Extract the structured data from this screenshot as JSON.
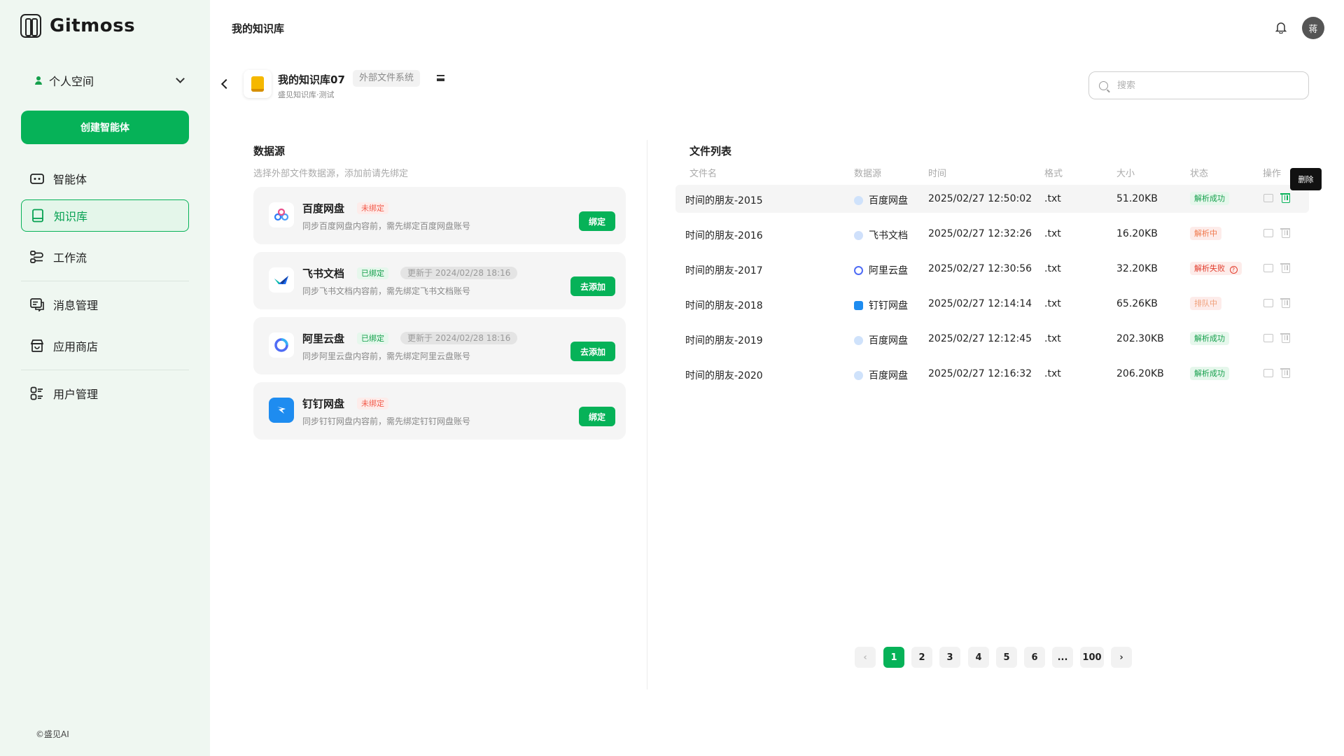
{
  "brand": {
    "name": "Gitmoss"
  },
  "sidebar": {
    "space_label": "个人空间",
    "create_button": "创建智能体",
    "items": [
      {
        "label": "智能体"
      },
      {
        "label": "知识库"
      },
      {
        "label": "工作流"
      },
      {
        "label": "消息管理"
      },
      {
        "label": "应用商店"
      },
      {
        "label": "用户管理"
      }
    ],
    "footer": "©盛见AI"
  },
  "header": {
    "title": "我的知识库",
    "avatar_text": "蒋"
  },
  "kb": {
    "title": "我的知识库07",
    "tag": "外部文件系统",
    "subtitle": "盛见知识库·测试"
  },
  "search": {
    "placeholder": "搜索"
  },
  "sources": {
    "title": "数据源",
    "subtitle": "选择外部文件数据源，添加前请先绑定",
    "items": [
      {
        "name": "百度网盘",
        "status": "未绑定",
        "updated": "",
        "desc": "同步百度网盘内容前，需先绑定百度网盘账号",
        "action": "绑定"
      },
      {
        "name": "飞书文档",
        "status": "已绑定",
        "updated": "更新于 2024/02/28 18:16",
        "desc": "同步飞书文档内容前，需先绑定飞书文档账号",
        "action": "去添加"
      },
      {
        "name": "阿里云盘",
        "status": "已绑定",
        "updated": "更新于 2024/02/28 18:16",
        "desc": "同步阿里云盘内容前，需先绑定阿里云盘账号",
        "action": "去添加"
      },
      {
        "name": "钉钉网盘",
        "status": "未绑定",
        "updated": "",
        "desc": "同步钉钉网盘内容前，需先绑定钉钉网盘账号",
        "action": "绑定"
      }
    ]
  },
  "files": {
    "title": "文件列表",
    "columns": [
      "文件名",
      "数据源",
      "时间",
      "格式",
      "大小",
      "状态",
      "操作"
    ],
    "rows": [
      {
        "name": "时间的朋友-2015",
        "source": "百度网盘",
        "time": "2025/02/27  12:50:02",
        "format": ".txt",
        "size": "51.20KB",
        "status": "解析成功"
      },
      {
        "name": "时间的朋友-2016",
        "source": "飞书文档",
        "time": "2025/02/27  12:32:26",
        "format": ".txt",
        "size": "16.20KB",
        "status": "解析中"
      },
      {
        "name": "时间的朋友-2017",
        "source": "阿里云盘",
        "time": "2025/02/27  12:30:56",
        "format": ".txt",
        "size": "32.20KB",
        "status": "解析失败"
      },
      {
        "name": "时间的朋友-2018",
        "source": "钉钉网盘",
        "time": "2025/02/27  12:14:14",
        "format": ".txt",
        "size": "65.26KB",
        "status": "排队中"
      },
      {
        "name": "时间的朋友-2019",
        "source": "百度网盘",
        "time": "2025/02/27  12:12:45",
        "format": ".txt",
        "size": "202.30KB",
        "status": "解析成功"
      },
      {
        "name": "时间的朋友-2020",
        "source": "百度网盘",
        "time": "2025/02/27  12:16:32",
        "format": ".txt",
        "size": "206.20KB",
        "status": "解析成功"
      }
    ],
    "tooltip": "删除"
  },
  "pagination": {
    "pages": [
      "1",
      "2",
      "3",
      "4",
      "5",
      "6",
      "...",
      "100"
    ],
    "current": "1"
  },
  "colors": {
    "accent": "#06b258",
    "sidebar_bg": "#eff7f1"
  }
}
